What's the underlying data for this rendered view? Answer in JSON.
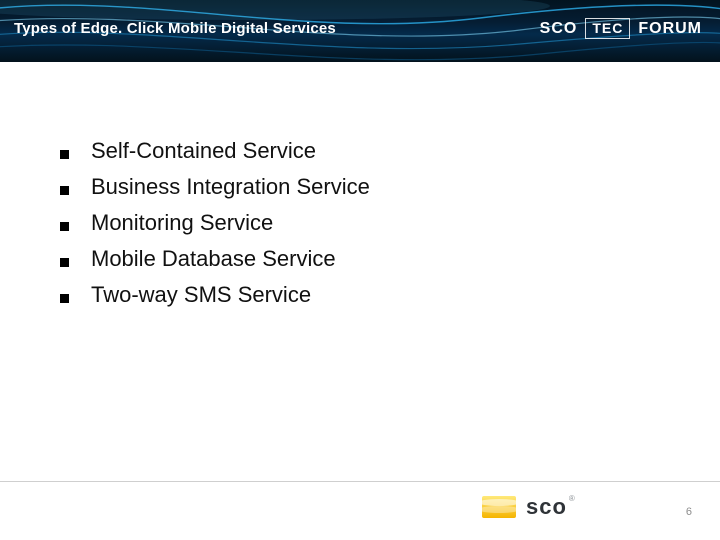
{
  "header": {
    "title": "Types of Edge. Click Mobile Digital Services",
    "brand_sco": "SCO",
    "brand_tec": "TEC",
    "brand_forum": "FORUM"
  },
  "bullets": [
    "Self-Contained Service",
    "Business Integration Service",
    "Monitoring Service",
    "Mobile Database Service",
    "Two-way SMS Service"
  ],
  "footer": {
    "logo_text": "sco",
    "registered": "®",
    "page_number": "6"
  }
}
